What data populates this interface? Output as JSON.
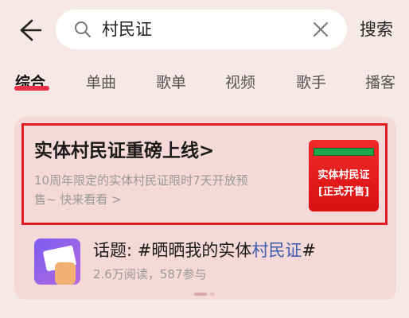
{
  "header": {
    "back_icon": "back-arrow-icon",
    "search": {
      "query": "村民证",
      "search_icon": "search-icon",
      "clear_icon": "close-icon"
    },
    "search_button_label": "搜索"
  },
  "tabs": [
    {
      "label": "综合",
      "active": true
    },
    {
      "label": "单曲",
      "active": false
    },
    {
      "label": "歌单",
      "active": false
    },
    {
      "label": "视频",
      "active": false
    },
    {
      "label": "歌手",
      "active": false
    },
    {
      "label": "播客",
      "active": false
    }
  ],
  "promo": {
    "title": "实体村民证重磅上线",
    "chevron": ">",
    "description_line1": "10周年限定的实体村民证限时7天开放预",
    "description_line2": "售~ 快来看看 >",
    "thumbnail": {
      "strip_text": "",
      "line1": "实体村民证",
      "line2": "[正式开售]"
    },
    "accent_color": "#e11b22"
  },
  "topic": {
    "prefix": "话题: #晒晒我的实体",
    "highlight": "村民证",
    "suffix": "#",
    "stats": "2.6万阅读，587参与",
    "highlight_color": "#3c5db0"
  }
}
